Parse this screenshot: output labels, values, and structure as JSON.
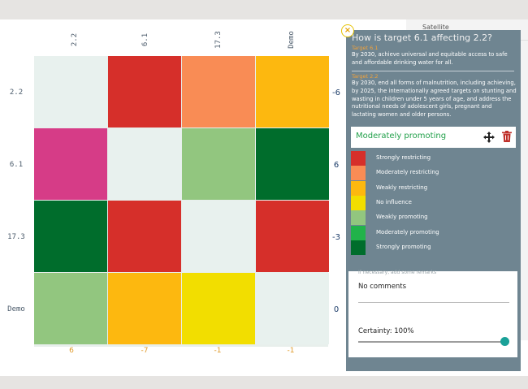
{
  "matrix": {
    "col_labels": [
      "2.2",
      "6.1",
      "17.3",
      "Demo"
    ],
    "row_labels": [
      "2.2",
      "6.1",
      "17.3",
      "Demo"
    ],
    "row_totals": [
      "-6",
      "6",
      "-3",
      "0"
    ],
    "col_totals": [
      "6",
      "-7",
      "-1",
      "-1"
    ],
    "cells": [
      [
        "#e8f1ee",
        "#d62f2a",
        "#f98c55",
        "#fdb80f"
      ],
      [
        "#d63c87",
        "#e8f1ee",
        "#92c67f",
        "#006d2c"
      ],
      [
        "#006d2c",
        "#d62f2a",
        "#e8f1ee",
        "#d62f2a"
      ],
      [
        "#92c67f",
        "#fdb80f",
        "#f2de00",
        "#e8f1ee"
      ]
    ]
  },
  "panel": {
    "close": "×",
    "title": "How is target 6.1 affecting 2.2?",
    "target_a_heading": "Target 6.1",
    "target_a_text": "By 2030, achieve universal and equitable access to safe and affordable drinking water for all.",
    "target_b_heading": "Target 2.2",
    "target_b_text": "By 2030, end all forms of malnutrition, including achieving, by 2025, the internationally agreed targets on stunting and wasting in children under 5 years of age, and address the nutritional needs of adolescent girls, pregnant and lactating women and older persons.",
    "selected_label": "Moderately promoting",
    "selected_color": "#21a04a",
    "legend": [
      {
        "label": "Strongly restricting",
        "color": "#d62f2a"
      },
      {
        "label": "Moderately restricting",
        "color": "#f98c55"
      },
      {
        "label": "Weakly restricting",
        "color": "#fdb80f"
      },
      {
        "label": "No influence",
        "color": "#f2de00"
      },
      {
        "label": "Weakly promoting",
        "color": "#92c67f"
      },
      {
        "label": "Moderately promoting",
        "color": "#21b34a"
      },
      {
        "label": "Strongly promoting",
        "color": "#006d2c"
      }
    ],
    "remarks_placeholder": "If necessary, add some remarks",
    "remarks_value": "No comments",
    "certainty_label": "Certainty: 100%",
    "certainty_value": 1.0
  },
  "behind_panel": {
    "items": [
      "Satellite"
    ]
  }
}
